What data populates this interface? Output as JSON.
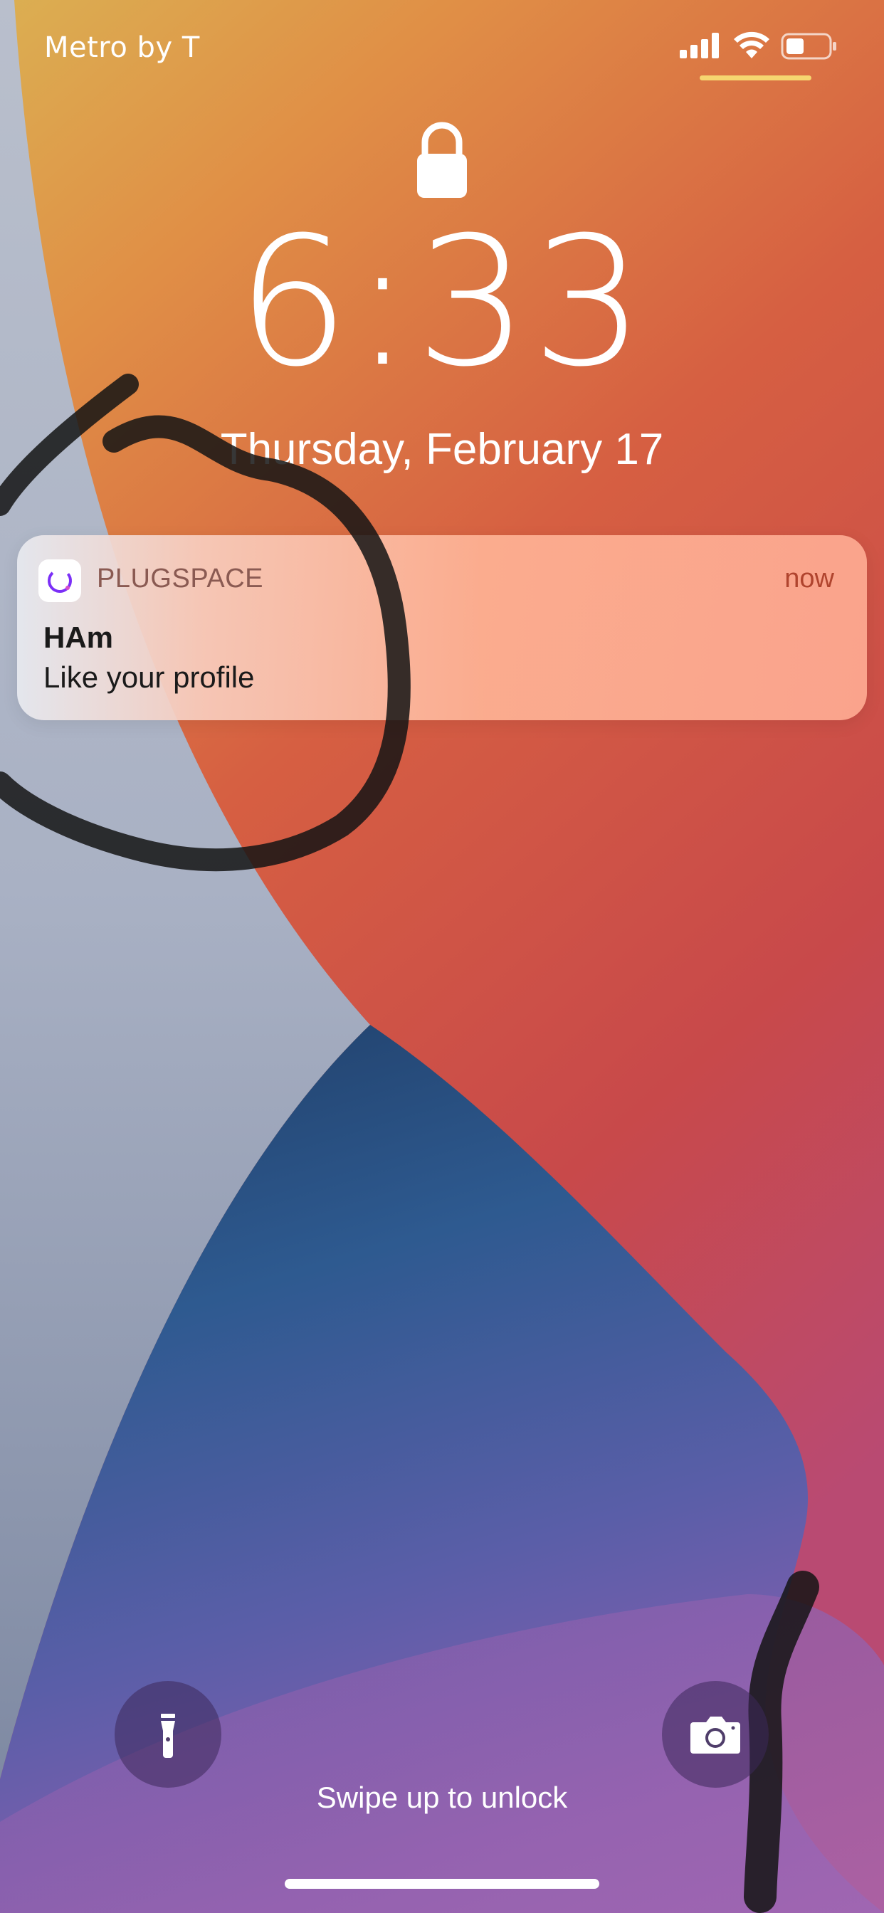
{
  "status_bar": {
    "carrier": "Metro by T"
  },
  "lock_screen": {
    "time": "6:33",
    "date": "Thursday, February 17"
  },
  "notification": {
    "app_name": "PLUGSPACE",
    "time": "now",
    "title": "HAm",
    "body": "Like your profile"
  },
  "footer": {
    "swipe_hint": "Swipe up to unlock"
  },
  "icons": {
    "signal": "cellular-signal-icon",
    "wifi": "wifi-icon",
    "battery": "battery-icon",
    "lock": "lock-icon",
    "flashlight": "flashlight-icon",
    "camera": "camera-icon",
    "app": "plugspace-app-icon"
  },
  "colors": {
    "notification_time": "#b0442e",
    "status_underline": "#f6d670",
    "app_icon_accent": "#7b2ff7"
  }
}
